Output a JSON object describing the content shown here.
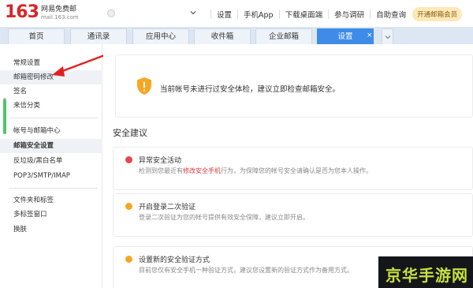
{
  "header": {
    "logo_number": "163",
    "logo_title": "网易免费邮",
    "logo_domain": "mail.163.com",
    "nav_links": [
      "设置",
      "手机App",
      "下载桌面端",
      "参与调研",
      "自助查询"
    ],
    "vip_label": "开通邮箱会员"
  },
  "tabs": [
    {
      "label": "首页"
    },
    {
      "label": "通讯录"
    },
    {
      "label": "应用中心"
    },
    {
      "label": "收件箱"
    },
    {
      "label": "企业邮箱"
    },
    {
      "label": "设置",
      "active": true
    }
  ],
  "tab_close_glyph": "×",
  "sidebar": {
    "items": [
      "常规设置",
      "邮箱密码修改",
      "签名",
      "来信分类",
      "帐号与邮箱中心",
      "邮箱安全设置",
      "反垃圾/黑白名单",
      "POP3/SMTP/IMAP",
      "文件夹和标签",
      "多标签窗口",
      "换肤"
    ]
  },
  "main": {
    "alert_text": "当前帐号未进行过安全体检，建议立即检查邮箱安全。",
    "section_title": "安全建议",
    "cards": [
      {
        "title": "异常安全活动",
        "desc_before": "检测到您最近有",
        "desc_link": "修改安全手机",
        "desc_after": "行为，为保障您的帐号安全请确认是否为您本人操作。",
        "icon_color": "#e5484d"
      },
      {
        "title": "开启登录二次验证",
        "desc": "登录二次验证为您的帐号提供有效安全保障，建议立即开启。",
        "icon_color": "#f5a623"
      },
      {
        "title": "设置新的安全验证方式",
        "desc": "目前您仅有安全手机一种验证方式，建议您设置新的验证方式作为备用方式。",
        "icon_color": "#f5a623"
      }
    ]
  },
  "watermark": "京华手游网",
  "colors": {
    "brand_red": "#d8252b",
    "accent_blue": "#3f8ce8",
    "warning_orange": "#f5a623",
    "danger_red": "#e5484d",
    "annotation_red": "#e02020"
  }
}
